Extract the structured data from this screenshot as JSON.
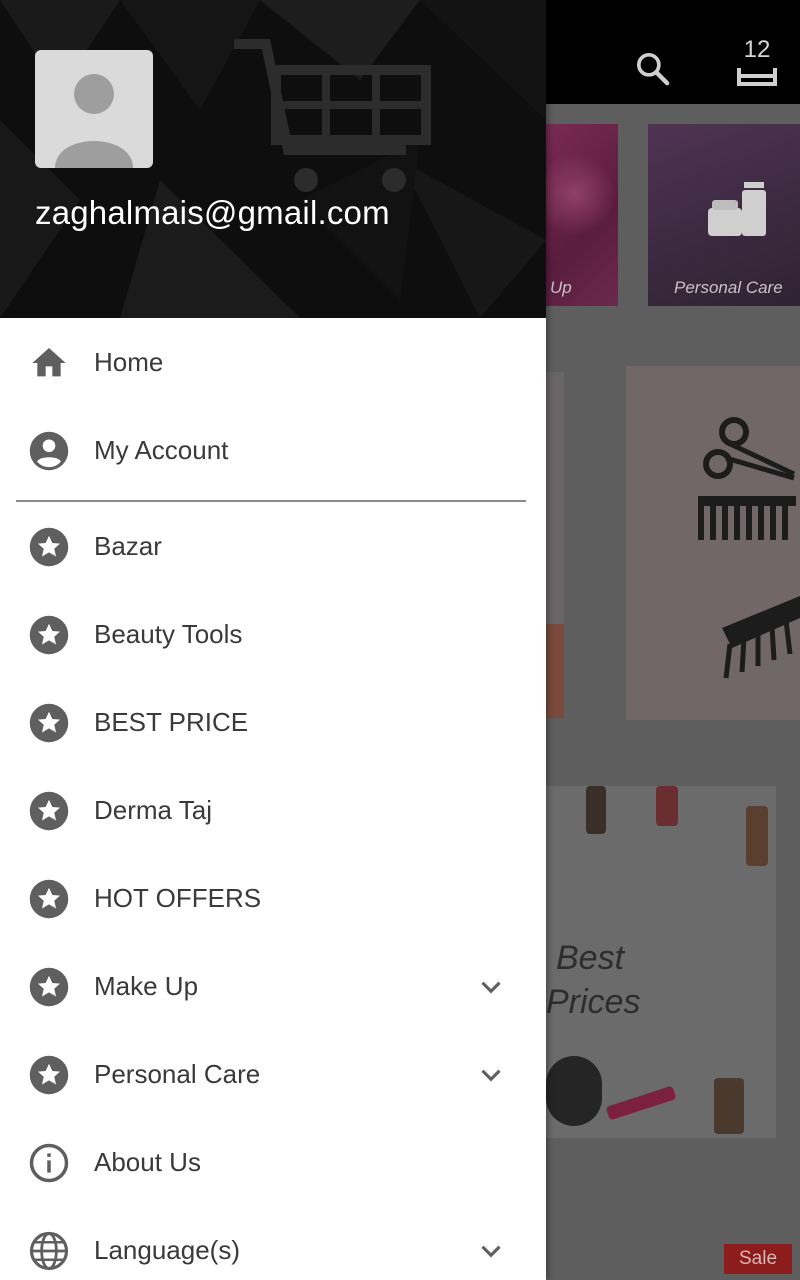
{
  "drawer": {
    "header": {
      "email": "zaghalmais@gmail.com"
    },
    "primary_items": [
      {
        "label": "Home",
        "icon": "home-icon"
      },
      {
        "label": "My Account",
        "icon": "account-circle-icon"
      }
    ],
    "category_items": [
      {
        "label": "Bazar",
        "icon": "star-circle-icon",
        "expandable": false
      },
      {
        "label": "Beauty Tools",
        "icon": "star-circle-icon",
        "expandable": false
      },
      {
        "label": "BEST PRICE",
        "icon": "star-circle-icon",
        "expandable": false
      },
      {
        "label": "Derma Taj",
        "icon": "star-circle-icon",
        "expandable": false
      },
      {
        "label": "HOT OFFERS",
        "icon": "star-circle-icon",
        "expandable": false
      },
      {
        "label": "Make Up",
        "icon": "star-circle-icon",
        "expandable": true
      },
      {
        "label": "Personal Care",
        "icon": "star-circle-icon",
        "expandable": true
      }
    ],
    "other_items": [
      {
        "label": "About Us",
        "icon": "info-icon",
        "expandable": false
      },
      {
        "label": "Language(s)",
        "icon": "globe-icon",
        "expandable": true
      }
    ]
  },
  "app": {
    "cart_count": "12",
    "categories": [
      {
        "label": "Up"
      },
      {
        "label": "Personal Care"
      }
    ],
    "banner": {
      "line1": "Best",
      "line2": "Prices"
    },
    "sale_badge": "Sale"
  },
  "colors": {
    "drawer_bg": "#ffffff",
    "header_bg": "#0e0e0e",
    "icon_gray": "#5f5f5f",
    "text_gray": "#3a3a3a",
    "sale_red": "#8d1c1c"
  }
}
